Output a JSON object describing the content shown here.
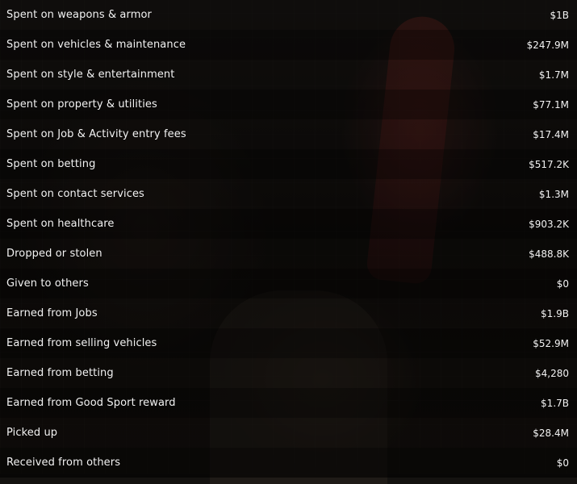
{
  "stats": {
    "rows": [
      {
        "label": "Spent on weapons & armor",
        "value": "$1B"
      },
      {
        "label": "Spent on vehicles & maintenance",
        "value": "$247.9M"
      },
      {
        "label": "Spent on style & entertainment",
        "value": "$1.7M"
      },
      {
        "label": "Spent on property & utilities",
        "value": "$77.1M"
      },
      {
        "label": "Spent on Job & Activity entry fees",
        "value": "$17.4M"
      },
      {
        "label": "Spent on betting",
        "value": "$517.2K"
      },
      {
        "label": "Spent on contact services",
        "value": "$1.3M"
      },
      {
        "label": "Spent on healthcare",
        "value": "$903.2K"
      },
      {
        "label": "Dropped or stolen",
        "value": "$488.8K"
      },
      {
        "label": "Given to others",
        "value": "$0"
      },
      {
        "label": "Earned from Jobs",
        "value": "$1.9B"
      },
      {
        "label": "Earned from selling vehicles",
        "value": "$52.9M"
      },
      {
        "label": "Earned from betting",
        "value": "$4,280"
      },
      {
        "label": "Earned from Good Sport reward",
        "value": "$1.7B"
      },
      {
        "label": "Picked up",
        "value": "$28.4M"
      },
      {
        "label": "Received from others",
        "value": "$0"
      }
    ]
  }
}
